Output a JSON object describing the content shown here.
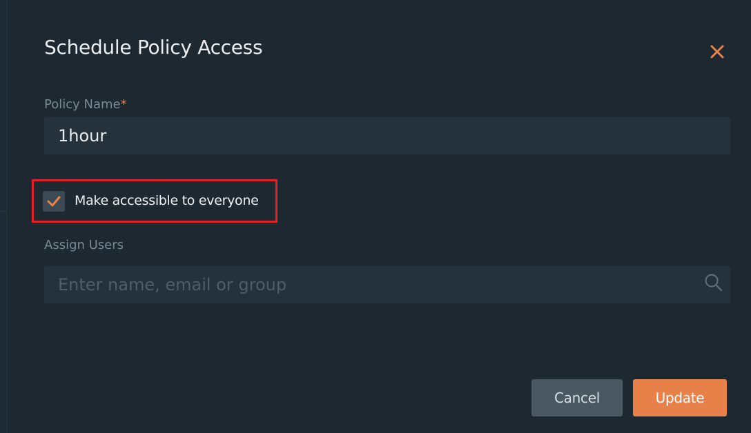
{
  "dialog": {
    "title": "Schedule Policy Access"
  },
  "policy_name": {
    "label": "Policy Name",
    "required_marker": "*",
    "value": "1hour"
  },
  "access": {
    "checkbox_label": "Make accessible to everyone",
    "checked": true
  },
  "assign_users": {
    "label": "Assign Users",
    "placeholder": "Enter name, email or group",
    "icon": "search-icon"
  },
  "actions": {
    "cancel_label": "Cancel",
    "update_label": "Update"
  },
  "colors": {
    "background": "#1d2831",
    "input_background": "#25323c",
    "accent": "#e8804a",
    "highlight": "#e2212b",
    "cancel_button": "#4a5861"
  }
}
